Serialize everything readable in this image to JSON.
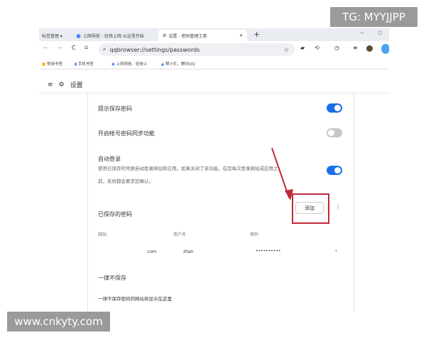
{
  "watermarks": {
    "top_right": "TG: MYYJJPP",
    "bottom_left": "www.cnkyty.com"
  },
  "tabs": [
    {
      "label": "标签管理 ▾"
    },
    {
      "label": "上网导航 - 轻快上网 从这里开始",
      "icon": "qq-browser-icon"
    },
    {
      "label": "设置 - 密码管理工具",
      "icon": "gear-icon",
      "active": true
    }
  ],
  "new_tab": "+",
  "address": {
    "url": "qqbrowser://settings/passwords"
  },
  "bookmarks": [
    {
      "label": "常用书签"
    },
    {
      "label": "手机书签"
    },
    {
      "label": "上网导航 - 轻快上"
    },
    {
      "label": "帮小忙，腾讯QQ"
    }
  ],
  "settings": {
    "title": "设置",
    "offer_save": {
      "label": "提示保存密码",
      "on": true
    },
    "sync": {
      "label": "开启帐号密码同步功能",
      "on": false
    },
    "auto_login": {
      "label": "自动登录",
      "desc1": "使用已保存的凭据自动登录网站和应用。如果关闭了该功能，在您每次登录网站或应用之",
      "desc2": "前，系统都会要求您确认。",
      "on": true
    },
    "saved": {
      "title": "已保存的密码",
      "add": "添加",
      "columns": [
        "网站",
        "用户名",
        "密码"
      ],
      "rows": [
        {
          "site": ".com",
          "user": "zhan",
          "password": "••••••••••"
        }
      ]
    },
    "never": {
      "title": "一律不保存",
      "empty": "一律不保存密码的网站将显示在这里"
    }
  },
  "colors": {
    "accent": "#1a6fe8",
    "highlight_box": "#c0283a"
  }
}
